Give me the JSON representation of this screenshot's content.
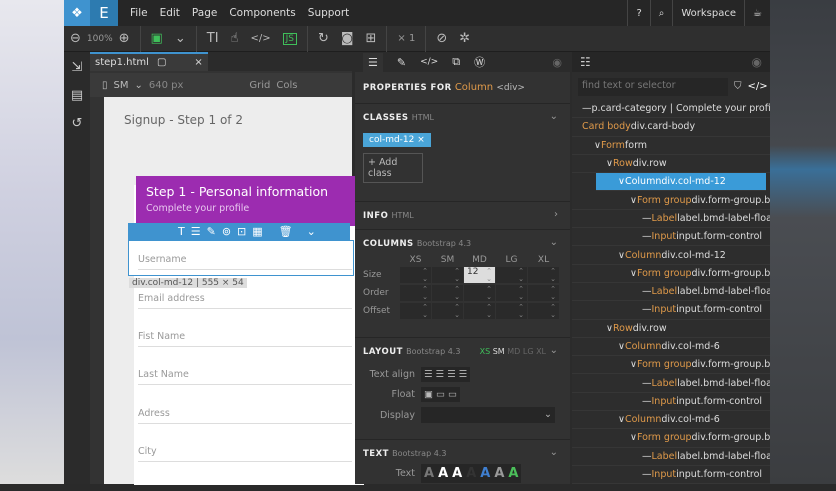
{
  "menu": {
    "items": [
      "File",
      "Edit",
      "Page",
      "Components",
      "Support"
    ],
    "logo_letter": "E",
    "workspace": "Workspace"
  },
  "toolbar": {
    "zoom": "100%",
    "multiplier": "× 1",
    "js": "JS"
  },
  "canvas": {
    "tab": "step1.html",
    "device": "SM",
    "width": "640 px",
    "grid": "Grid",
    "cols": "Cols",
    "page_title": "Signup - Step 1 of 2",
    "card_title": "Step 1 - Personal information",
    "card_subtitle": "Complete your profile",
    "selection_label": "div.col-md-12 | 555 × 54",
    "fields": [
      "Username",
      "Email address",
      "Fist Name",
      "Last Name",
      "Adress",
      "City"
    ]
  },
  "props": {
    "header_prefix": "PROPERTIES FOR",
    "header_name": "Column",
    "header_tag": "<div>",
    "classes": {
      "title": "CLASSES",
      "sub": "HTML",
      "class": "col-md-12",
      "add": "+ Add class"
    },
    "info": {
      "title": "INFO",
      "sub": "HTML"
    },
    "columns": {
      "title": "COLUMNS",
      "sub": "Bootstrap 4.3",
      "breakpoints": [
        "XS",
        "SM",
        "MD",
        "LG",
        "XL"
      ],
      "rows": [
        "Size",
        "Order",
        "Offset"
      ],
      "md_size": "12"
    },
    "layout": {
      "title": "LAYOUT",
      "sub": "Bootstrap 4.3",
      "bps": [
        "XS",
        "SM",
        "MD",
        "LG",
        "XL"
      ],
      "text_align": "Text align",
      "float": "Float",
      "display": "Display"
    },
    "text": {
      "title": "TEXT",
      "sub": "Bootstrap 4.3",
      "label": "Text"
    }
  },
  "tree": {
    "search_placeholder": "find text or selector",
    "rows": [
      {
        "pre": "— ",
        "o": "",
        "t": "p.card-category | Complete your profi...",
        "indent": 0
      },
      {
        "pre": "",
        "o": "Card body",
        "t": " div.card-body",
        "indent": 0
      },
      {
        "pre": "∨ ",
        "o": "Form",
        "t": " form",
        "indent": 1
      },
      {
        "pre": "∨ ",
        "o": "Row",
        "t": " div.row",
        "indent": 2
      },
      {
        "pre": "∨ ",
        "o": "Column",
        "t": " div.col-md-12",
        "indent": 3,
        "sel": true
      },
      {
        "pre": "∨ ",
        "o": "Form group",
        "t": " div.form-group.bm",
        "indent": 4
      },
      {
        "pre": "— ",
        "o": "Label",
        "t": " label.bmd-label-floatir",
        "indent": 5
      },
      {
        "pre": "— ",
        "o": "Input",
        "t": " input.form-control",
        "indent": 5
      },
      {
        "pre": "∨ ",
        "o": "Column",
        "t": " div.col-md-12",
        "indent": 3
      },
      {
        "pre": "∨ ",
        "o": "Form group",
        "t": " div.form-group.bm",
        "indent": 4
      },
      {
        "pre": "— ",
        "o": "Label",
        "t": " label.bmd-label-floatir",
        "indent": 5
      },
      {
        "pre": "— ",
        "o": "Input",
        "t": " input.form-control",
        "indent": 5
      },
      {
        "pre": "∨ ",
        "o": "Row",
        "t": " div.row",
        "indent": 2
      },
      {
        "pre": "∨ ",
        "o": "Column",
        "t": " div.col-md-6",
        "indent": 3
      },
      {
        "pre": "∨ ",
        "o": "Form group",
        "t": " div.form-group.bm",
        "indent": 4
      },
      {
        "pre": "— ",
        "o": "Label",
        "t": " label.bmd-label-floatir",
        "indent": 5
      },
      {
        "pre": "— ",
        "o": "Input",
        "t": " input.form-control",
        "indent": 5
      },
      {
        "pre": "∨ ",
        "o": "Column",
        "t": " div.col-md-6",
        "indent": 3
      },
      {
        "pre": "∨ ",
        "o": "Form group",
        "t": " div.form-group.bm",
        "indent": 4
      },
      {
        "pre": "— ",
        "o": "Label",
        "t": " label.bmd-label-floatir",
        "indent": 5
      },
      {
        "pre": "— ",
        "o": "Input",
        "t": " input.form-control",
        "indent": 5
      }
    ]
  }
}
